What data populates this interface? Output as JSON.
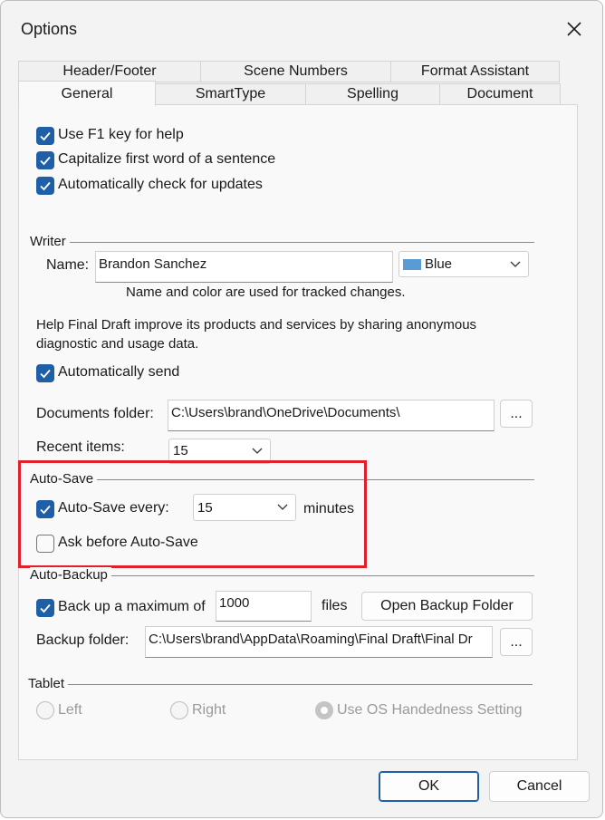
{
  "window": {
    "title": "Options"
  },
  "tabs": {
    "back_row": [
      "Header/Footer",
      "Scene Numbers",
      "Format Assistant"
    ],
    "front_row": [
      "General",
      "SmartType",
      "Spelling",
      "Document"
    ],
    "active": "General"
  },
  "general": {
    "use_f1": {
      "label": "Use F1 key for help",
      "checked": true
    },
    "capitalize": {
      "label": "Capitalize first word of a sentence",
      "checked": true
    },
    "check_updates": {
      "label": "Automatically check for updates",
      "checked": true
    }
  },
  "writer": {
    "group_title": "Writer",
    "name_label": "Name:",
    "name_value": "Brandon Sanchez",
    "color_value": "Blue",
    "color_swatch": "#5b9bd5",
    "hint": "Name and color are used for tracked changes."
  },
  "diagnostics": {
    "text_line1": "Help Final Draft improve its products and services by sharing anonymous",
    "text_line2": "diagnostic and usage data.",
    "auto_send": {
      "label": "Automatically send",
      "checked": true
    }
  },
  "documents": {
    "folder_label": "Documents folder:",
    "folder_value": "C:\\Users\\brand\\OneDrive\\Documents\\",
    "browse_label": "...",
    "recent_label": "Recent items:",
    "recent_value": "15"
  },
  "autosave": {
    "group_title": "Auto-Save",
    "every_label": "Auto-Save every:",
    "every_checked": true,
    "every_value": "15",
    "minutes_label": "minutes",
    "ask_label": "Ask before Auto-Save",
    "ask_checked": false
  },
  "autobackup": {
    "group_title": "Auto-Backup",
    "backup_label": "Back up a maximum of",
    "backup_checked": true,
    "backup_value": "1000",
    "files_label": "files",
    "open_folder_label": "Open Backup Folder",
    "folder_label": "Backup folder:",
    "folder_value": "C:\\Users\\brand\\AppData\\Roaming\\Final Draft\\Final Dr",
    "browse_label": "..."
  },
  "tablet": {
    "group_title": "Tablet",
    "left_label": "Left",
    "right_label": "Right",
    "os_label": "Use OS Handedness Setting",
    "selected": "Use OS Handedness Setting"
  },
  "footer": {
    "ok_label": "OK",
    "cancel_label": "Cancel"
  },
  "colors": {
    "accent": "#1f5fa8",
    "highlight_box": "#e0202a"
  }
}
